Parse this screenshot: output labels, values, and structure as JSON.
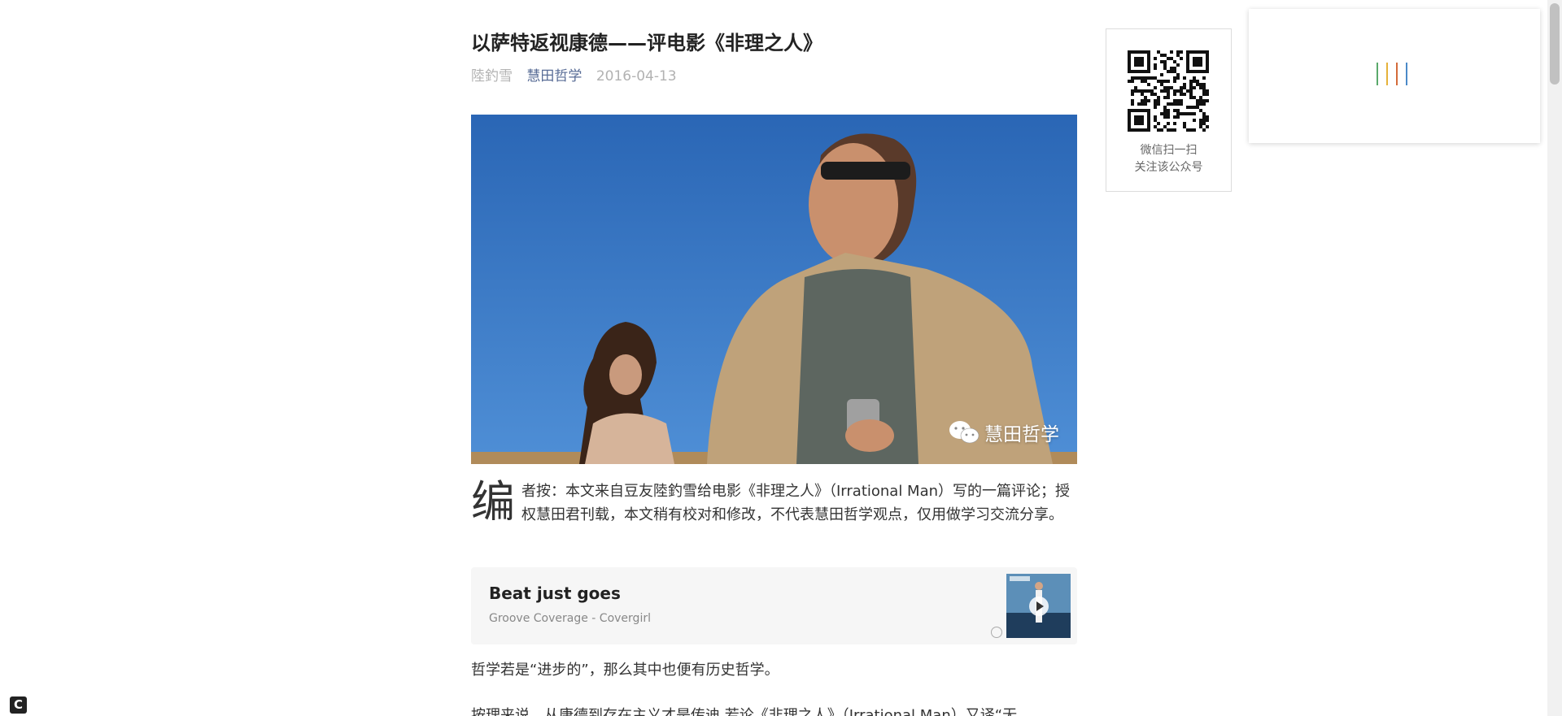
{
  "article": {
    "title": "以萨特返视康德——评电影《非理之人》",
    "author": "陸釣雪",
    "account": "慧田哲学",
    "date": "2016-04-13",
    "cover_watermark": "慧田哲学",
    "intro_dropcap": "编",
    "intro_text": "者按：本文来自豆友陸釣雪给电影《非理之人》（Irrational Man）写的一篇评论；授权慧田君刊载，本文稍有校对和修改，不代表慧田哲学观点，仅用做学习交流分享。",
    "paragraph_1": "哲学若是“进步的”，那么其中也便有历史哲学。",
    "paragraph_2": "按理来说，从康德到存在主义才是传迪 若论《非理之人》（Irrational Man）又译“无"
  },
  "music": {
    "song": "Beat just goes",
    "artist": "Groove Coverage - Covergirl"
  },
  "qr": {
    "line1": "微信扫一扫",
    "line2": "关注该公众号"
  },
  "loader": {
    "colors": [
      "#5aa96b",
      "#e6b23a",
      "#d46b3a",
      "#4a89c8"
    ]
  },
  "corner_icon": {
    "glyph": "C"
  }
}
